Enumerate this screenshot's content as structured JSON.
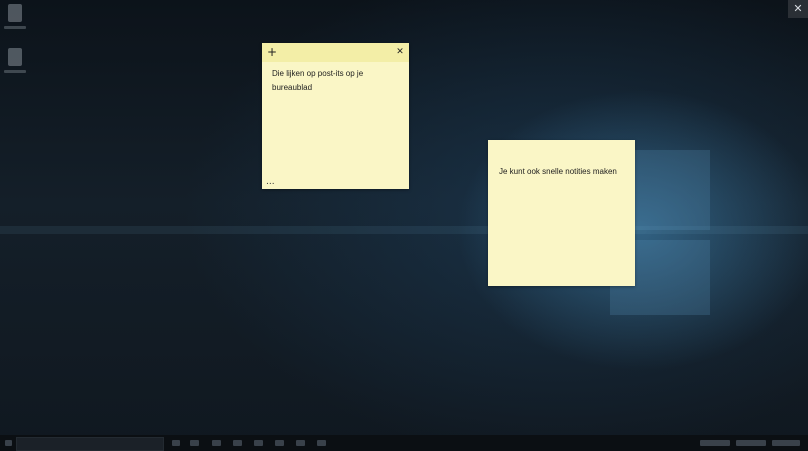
{
  "window": {
    "close_glyph": "✕"
  },
  "notes": [
    {
      "add_glyph": "+",
      "close_glyph": "✕",
      "text_line1": "Die lijken op post-its op  je",
      "text_line2": "bureaublad",
      "menu_glyph": "..."
    },
    {
      "text": "Je kunt ook snelle notities maken"
    }
  ],
  "colors": {
    "note_body": "#faf6c6",
    "note_header": "#f3eea7",
    "desktop": "#0f1720"
  }
}
